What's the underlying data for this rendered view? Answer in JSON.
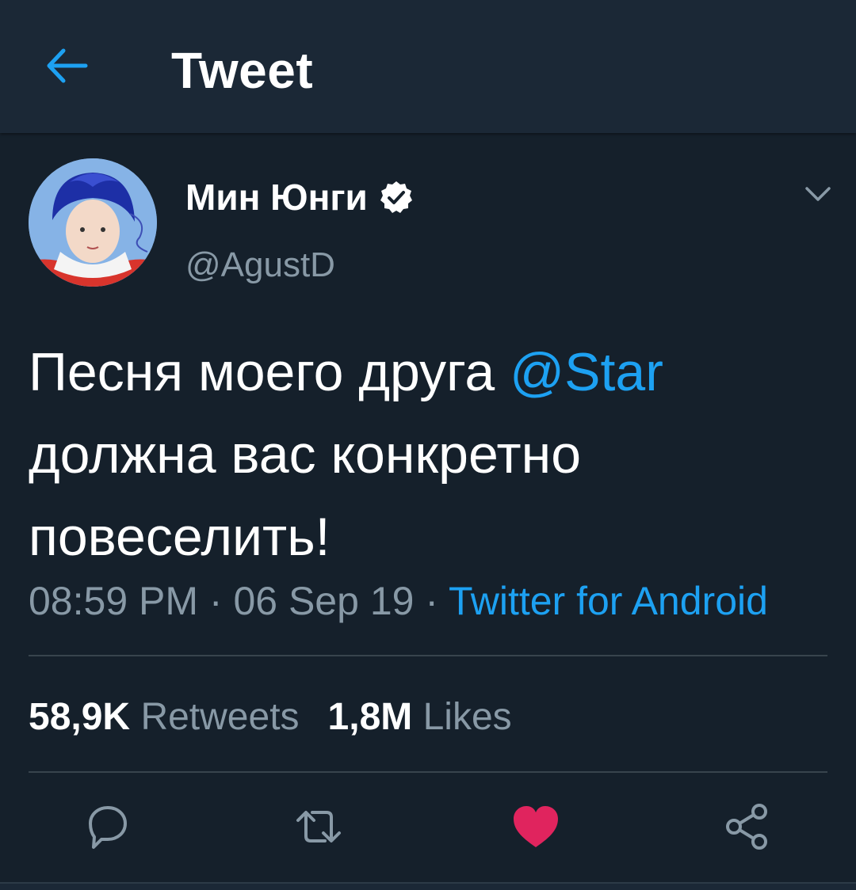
{
  "header": {
    "title": "Tweet",
    "back_icon": "arrow-left-icon"
  },
  "tweet": {
    "author_name": "Мин Юнги",
    "author_handle": "@AgustD",
    "verified": true,
    "text_line1": "Песня моего друга ",
    "mention": "@Star",
    "text_rest": "должна вас конкретно повеселить!",
    "time": "08:59 PM",
    "separator": " · ",
    "date": "06 Sep 19",
    "source": "Twitter for Android"
  },
  "stats": {
    "retweets_count": "58,9K",
    "retweets_label": "Retweets",
    "likes_count": "1,8M",
    "likes_label": "Likes"
  },
  "actions": [
    "reply-icon",
    "retweet-icon",
    "like-icon",
    "share-icon"
  ],
  "colors": {
    "background": "#15202b",
    "header": "#1b2836",
    "accent": "#1da1f2",
    "muted": "#8899a6",
    "like": "#e0245e",
    "divider": "#38444d"
  }
}
